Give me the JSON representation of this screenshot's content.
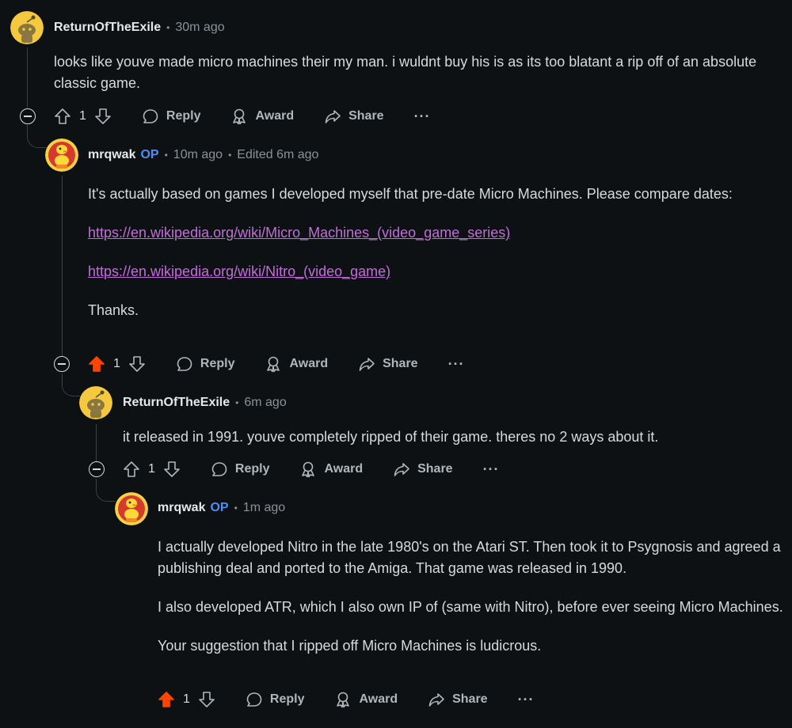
{
  "comments": [
    {
      "user": "ReturnOfTheExile",
      "op": "",
      "time": "30m ago",
      "edited": "",
      "paragraphs": [
        "looks like youve made micro machines their my man. i wuldnt buy his is as its too blatant a rip off of an absolute classic game."
      ],
      "votes": "1",
      "upvoted": false
    },
    {
      "user": "mrqwak",
      "op": "OP",
      "time": "10m ago",
      "edited": "Edited 6m ago",
      "paragraphs": [
        "It's actually based on games I developed myself that pre-date Micro Machines. Please compare dates:",
        "https://en.wikipedia.org/wiki/Micro_Machines_(video_game_series)",
        "https://en.wikipedia.org/wiki/Nitro_(video_game)",
        "Thanks."
      ],
      "votes": "1",
      "upvoted": true
    },
    {
      "user": "ReturnOfTheExile",
      "op": "",
      "time": "6m ago",
      "edited": "",
      "paragraphs": [
        "it released in 1991. youve completely ripped of their game. theres no 2 ways about it."
      ],
      "votes": "1",
      "upvoted": false
    },
    {
      "user": "mrqwak",
      "op": "OP",
      "time": "1m ago",
      "edited": "",
      "paragraphs": [
        "I actually developed Nitro in the late 1980's on the Atari ST. Then took it to Psygnosis and agreed a publishing deal and ported to the Amiga. That game was released in 1990.",
        "I also developed ATR, which I also own IP of (same with Nitro), before ever seeing Micro Machines.",
        "Your suggestion that I ripped off Micro Machines is ludicrous."
      ],
      "votes": "1",
      "upvoted": true
    }
  ],
  "actions": {
    "reply": "Reply",
    "award": "Award",
    "share": "Share",
    "more": "···"
  },
  "separator": "•",
  "colors": {
    "background": "#0e1113",
    "text": "#d7dadc",
    "muted": "#8b9196",
    "op_badge": "#4f8df7",
    "link": "#c26ddb",
    "upvote_active": "#ff4500",
    "thread_line": "#3a3f44"
  },
  "icons": [
    "snoo-avatar-icon",
    "duck-avatar-icon",
    "collapse-icon",
    "upvote-icon",
    "downvote-icon",
    "reply-icon",
    "award-icon",
    "share-icon",
    "more-icon"
  ]
}
